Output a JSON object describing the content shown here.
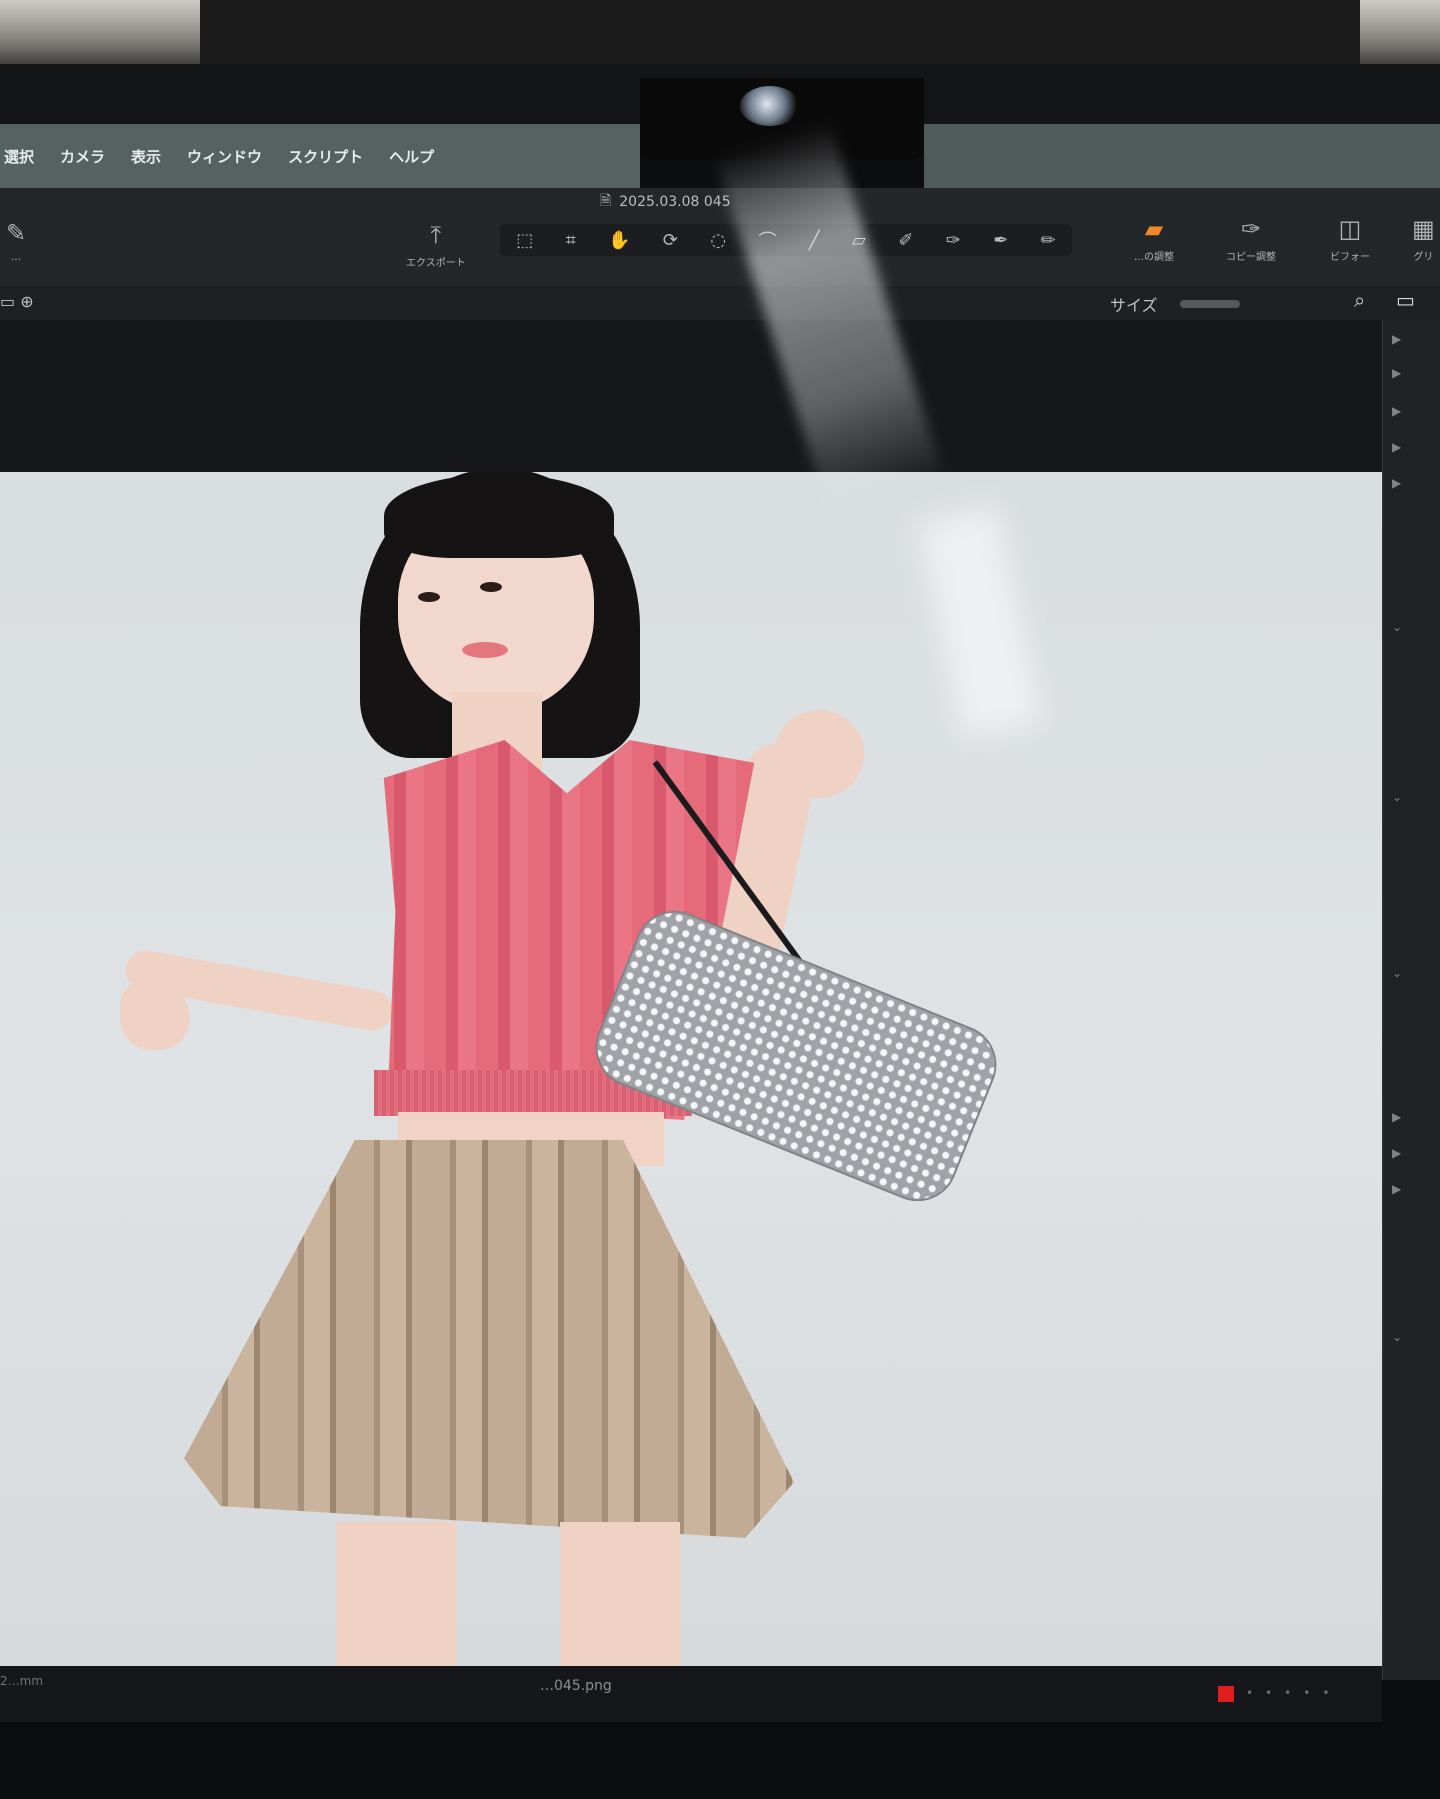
{
  "menu": {
    "items": [
      "選択",
      "カメラ",
      "表示",
      "ウィンドウ",
      "スクリプト",
      "ヘルプ"
    ]
  },
  "document": {
    "title": "2025.03.08 045"
  },
  "toolbar": {
    "export_label": "エクスポート",
    "left_label": "…",
    "right_buttons": [
      {
        "icon": "square-stack",
        "label": "…の調整"
      },
      {
        "icon": "eyedropper",
        "label": "コピー調整"
      },
      {
        "icon": "viewer",
        "label": "ビフォー"
      },
      {
        "icon": "grid",
        "label": "グリ"
      }
    ],
    "tools": [
      "select",
      "crop",
      "hand",
      "rotate",
      "lasso",
      "path",
      "brush",
      "eraser",
      "dodge",
      "picker",
      "pen",
      "marker",
      "brush-2"
    ]
  },
  "options": {
    "size_label": "サイズ"
  },
  "status": {
    "left": "2…mm",
    "filename": "…045.png"
  },
  "colors": {
    "accent": "#f0882a",
    "status_red": "#e01e1e"
  }
}
